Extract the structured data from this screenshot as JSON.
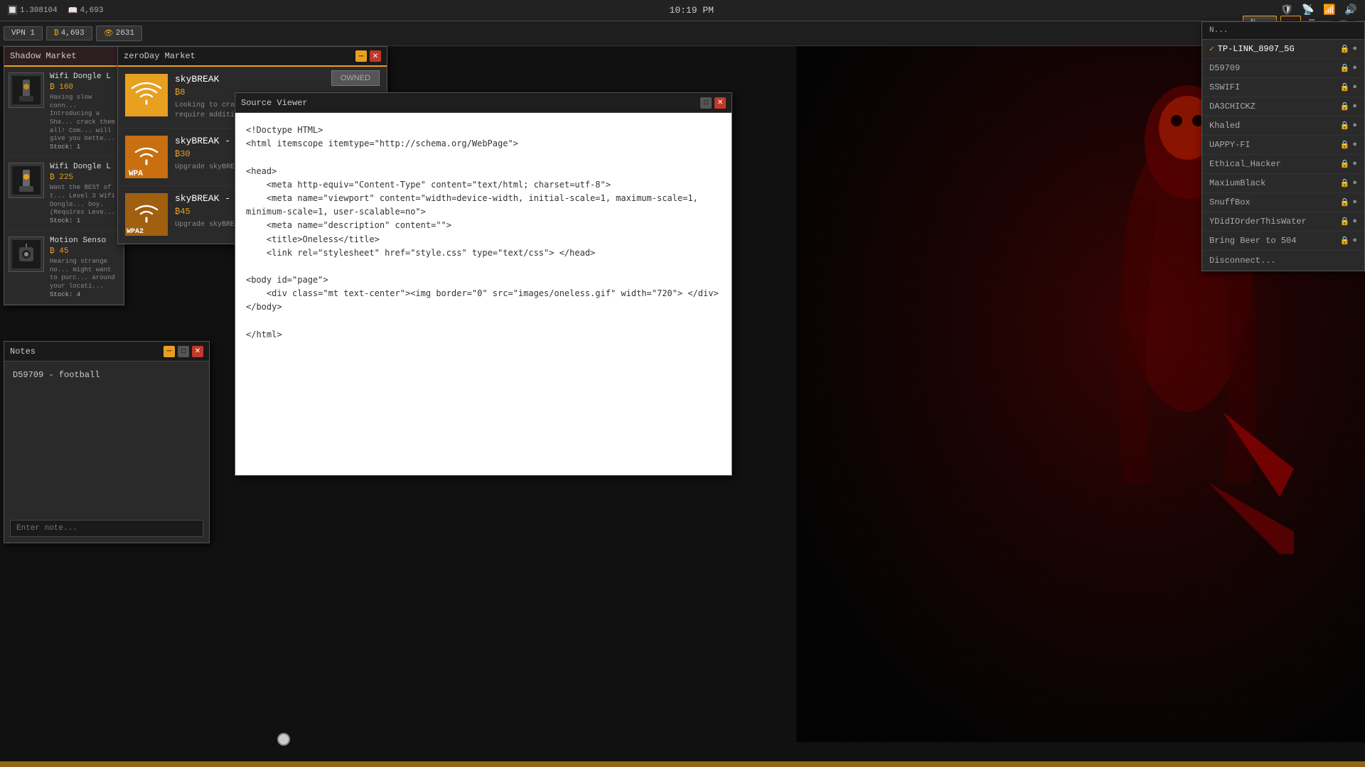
{
  "topbar": {
    "id": "1.308104",
    "time": "10:19 PM",
    "vpn": "VPN 1",
    "stat1": "4,693",
    "stat2": "2631"
  },
  "taskbar": {
    "buttons": [
      "N..."
    ]
  },
  "shadowMarket": {
    "title": "Shadow Market",
    "items": [
      {
        "name": "Wifi Dongle L",
        "price": "160",
        "desc": "Having slow conn... Introducing a Sha... crack them all! Com... will give you bette...",
        "stock": "Stock: 1"
      },
      {
        "name": "Wifi Dongle L",
        "price": "225",
        "desc": "Want the BEST of t... Level 3 Wifi Dongle... boy.(Requires Leve...",
        "stock": "Stock: 1"
      },
      {
        "name": "Motion Senso",
        "price": "45",
        "desc": "Hearing strange no... might want to purc... around your locati...",
        "stock": "Stock: 4"
      }
    ]
  },
  "zerodayMarket": {
    "title": "zeroDay Market",
    "items": [
      {
        "name": "skyBREAK",
        "price": "8",
        "desc": "Looking to crack som... crack them all! Com... require additional lib...",
        "badge": "OWNED"
      },
      {
        "name": "skyBREAK - W",
        "price": "30",
        "desc": "Upgrade skyBREAK w...",
        "badge": ""
      },
      {
        "name": "skyBREAK - W",
        "price": "45",
        "desc": "Upgrade skyBREAK w...",
        "badge": ""
      }
    ]
  },
  "sourceViewer": {
    "title": "Source Viewer",
    "content": "<!Doctype HTML>\n<html itemscope itemtype=\"http://schema.org/WebPage\">\n\n<head>\n    <meta http-equiv=\"Content-Type\" content=\"text/html; charset=utf-8\">\n    <meta name=\"viewport\" content=\"width=device-width, initial-scale=1, maximum-scale=1, minimum-scale=1, user-scalable=no\">\n    <meta name=\"description\" content=\"\">\n    <title>Oneless</title>\n    <link rel=\"stylesheet\" href=\"style.css\" type=\"text/css\"> </head>\n\n<body id=\"page\">\n    <div class=\"mt text-center\"><img border=\"0\" src=\"images/oneless.gif\" width=\"720\"> </div>\n</body>\n\n</html>"
  },
  "notes": {
    "title": "Notes",
    "content": "D59709 - football",
    "placeholder": "Enter note..."
  },
  "wifiDropdown": {
    "header": "N...",
    "networks": [
      {
        "name": "TP-LINK_8907_5G",
        "connected": true,
        "locked": true
      },
      {
        "name": "D59709",
        "connected": false,
        "locked": true
      },
      {
        "name": "SSWIFI",
        "connected": false,
        "locked": true
      },
      {
        "name": "DA3CHICKZ",
        "connected": false,
        "locked": true
      },
      {
        "name": "Khaled",
        "connected": false,
        "locked": true
      },
      {
        "name": "UAPPY-FI",
        "connected": false,
        "locked": true
      },
      {
        "name": "Ethical_Hacker",
        "connected": false,
        "locked": true
      },
      {
        "name": "MaxiumBlack",
        "connected": false,
        "locked": true
      },
      {
        "name": "SnuffBox",
        "connected": false,
        "locked": true
      },
      {
        "name": "YDidIOrderThisWater",
        "connected": false,
        "locked": true
      },
      {
        "name": "Bring Beer to 504",
        "connected": false,
        "locked": true
      }
    ],
    "disconnect": "Disconnect..."
  }
}
